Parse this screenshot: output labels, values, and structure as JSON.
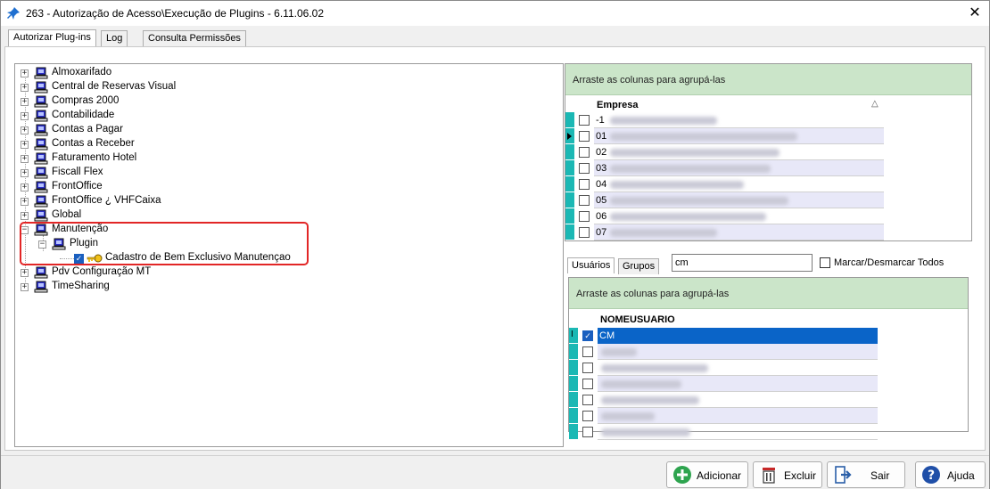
{
  "window": {
    "title": "263 - Autorização de Acesso\\Execução de Plugins - 6.11.06.02"
  },
  "tabs": [
    {
      "label": "Autorizar Plug-ins",
      "active": true
    },
    {
      "label": "Log",
      "active": false
    },
    {
      "label": "Consulta Permissões",
      "active": false
    }
  ],
  "tree": {
    "nodes": [
      {
        "label": "Almoxarifado",
        "expand": "+"
      },
      {
        "label": "Central de Reservas Visual",
        "expand": "+"
      },
      {
        "label": "Compras 2000",
        "expand": "+"
      },
      {
        "label": "Contabilidade",
        "expand": "+"
      },
      {
        "label": "Contas a Pagar",
        "expand": "+"
      },
      {
        "label": "Contas a Receber",
        "expand": "+"
      },
      {
        "label": "Faturamento Hotel",
        "expand": "+"
      },
      {
        "label": "Fiscall Flex",
        "expand": "+"
      },
      {
        "label": "FrontOffice",
        "expand": "+"
      },
      {
        "label": "FrontOffice ¿ VHFCaixa",
        "expand": "+"
      },
      {
        "label": "Global",
        "expand": "+"
      },
      {
        "label": "Manutenção",
        "expand": "−"
      },
      {
        "label": "Plugin",
        "expand": "−"
      },
      {
        "label": "Cadastro de Bem Exclusivo Manutençao",
        "checked": true
      },
      {
        "label": "Pdv Configuração MT",
        "expand": "+"
      },
      {
        "label": "TimeSharing",
        "expand": "+"
      }
    ]
  },
  "empresa_grid": {
    "group_hint": "Arraste as colunas para agrupá-las",
    "column": "Empresa",
    "sort_glyph": "△",
    "rows": [
      {
        "code": "-1"
      },
      {
        "code": "01"
      },
      {
        "code": "02"
      },
      {
        "code": "03"
      },
      {
        "code": "04"
      },
      {
        "code": "05"
      },
      {
        "code": "06"
      },
      {
        "code": "07"
      }
    ]
  },
  "user_tabs": [
    {
      "label": "Usuários",
      "active": true
    },
    {
      "label": "Grupos",
      "active": false
    }
  ],
  "search": {
    "value": "cm"
  },
  "mark_all": {
    "label": "Marcar/Desmarcar Todos"
  },
  "user_grid": {
    "group_hint": "Arraste as colunas para agrupá-las",
    "column": "NOMEUSUARIO",
    "selected": "CM",
    "row_count": 7
  },
  "buttons": {
    "add": "Adicionar",
    "delete": "Excluir",
    "exit": "Sair",
    "help": "Ajuda"
  },
  "colors": {
    "group_bar": "#cbe5c9",
    "indicator": "#1bb8b4",
    "selection": "#0a64c8",
    "highlight": "#e22626"
  }
}
